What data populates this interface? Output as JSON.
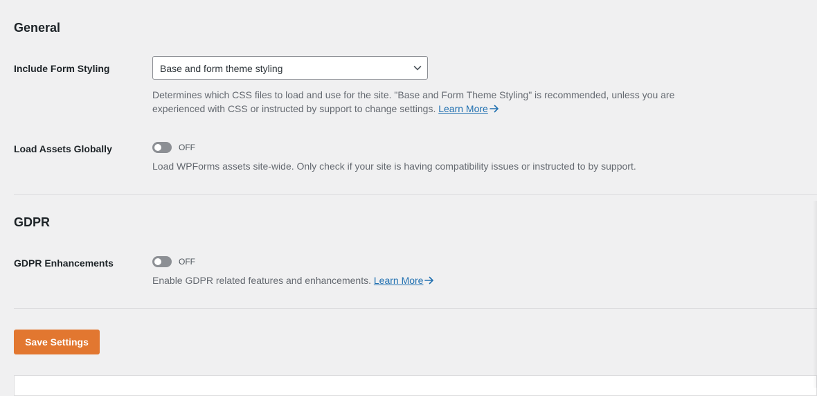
{
  "general": {
    "heading": "General",
    "form_styling": {
      "label": "Include Form Styling",
      "selected": "Base and form theme styling",
      "description": "Determines which CSS files to load and use for the site. \"Base and Form Theme Styling\" is recommended, unless you are experienced with CSS or instructed by support to change settings.",
      "learn_more": "Learn More"
    },
    "load_assets": {
      "label": "Load Assets Globally",
      "state": "OFF",
      "description": "Load WPForms assets site-wide. Only check if your site is having compatibility issues or instructed to by support."
    }
  },
  "gdpr": {
    "heading": "GDPR",
    "enhancements": {
      "label": "GDPR Enhancements",
      "state": "OFF",
      "description": "Enable GDPR related features and enhancements.",
      "learn_more": "Learn More"
    }
  },
  "actions": {
    "save_label": "Save Settings"
  },
  "colors": {
    "accent": "#e27730",
    "link": "#2271b1",
    "toggle_off": "#8c8f94",
    "background": "#f0f0f1"
  },
  "icons": {
    "select_arrow": "chevron-down-icon",
    "learn_more_arrow": "arrow-right-icon"
  }
}
